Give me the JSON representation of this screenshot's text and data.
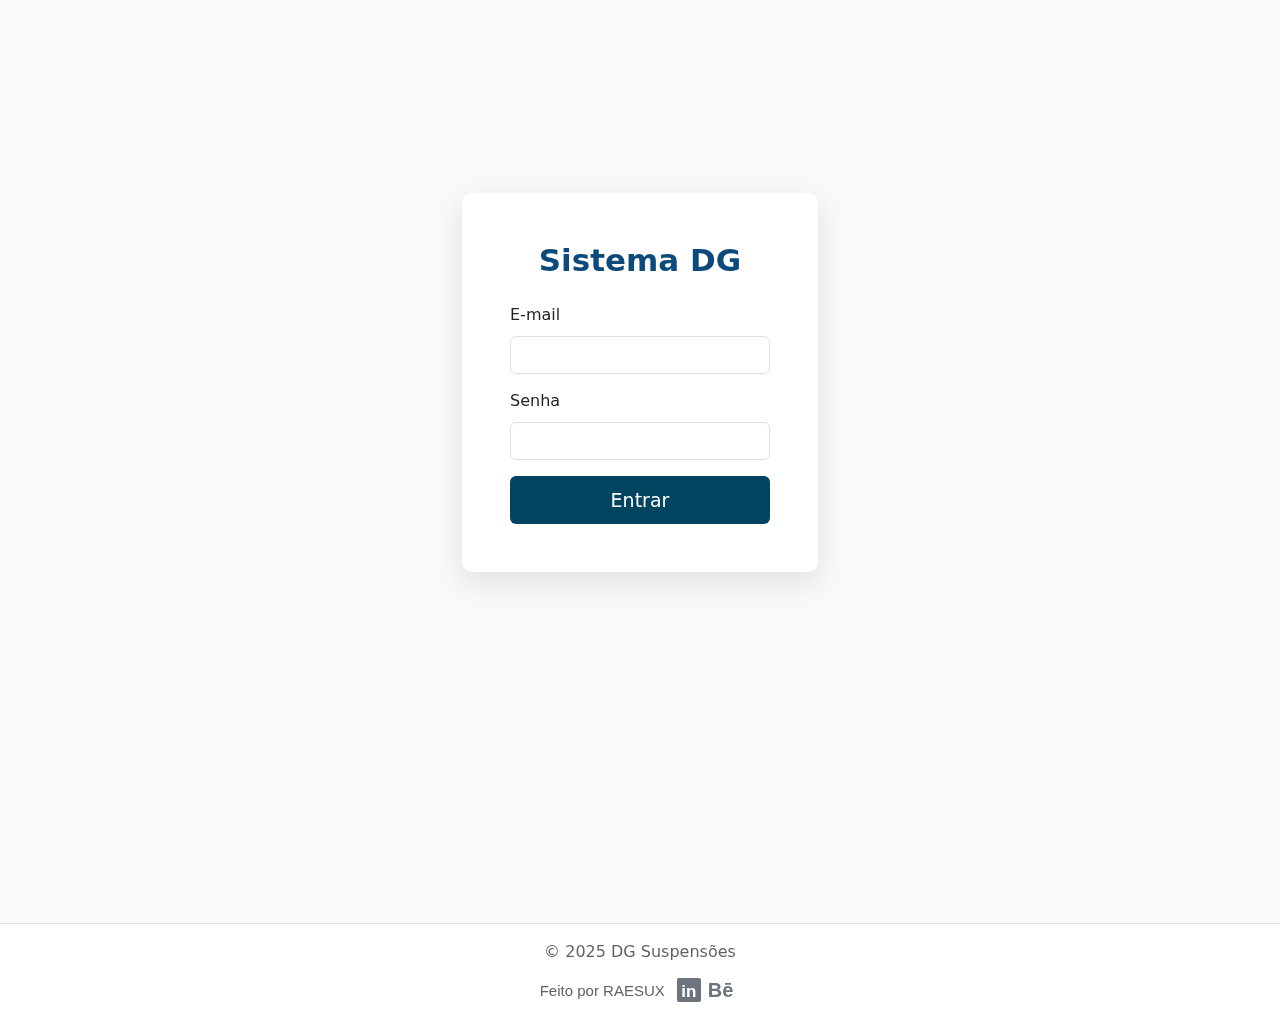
{
  "login": {
    "title": "Sistema DG",
    "fields": [
      {
        "label": "E-mail"
      },
      {
        "label": "Senha"
      }
    ],
    "submit": "Entrar"
  },
  "footer": {
    "copyright": "© 2025 DG Suspensões",
    "credit": "Feito por RAESUX",
    "links": [
      {
        "kind": "tile",
        "glyph": "in"
      },
      {
        "kind": "plain",
        "glyph": "Bē"
      }
    ]
  }
}
